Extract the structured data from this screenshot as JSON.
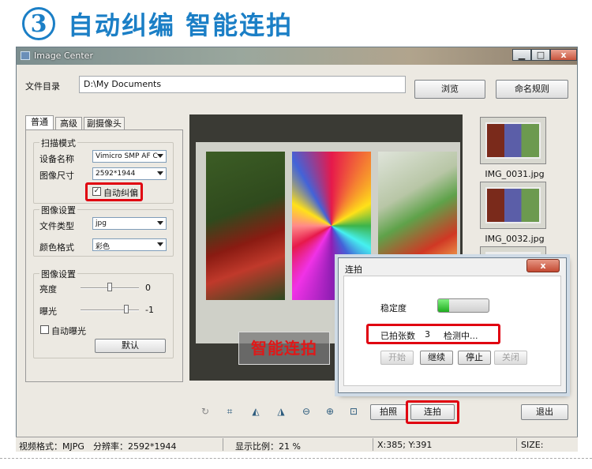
{
  "headline": {
    "step": "3",
    "title": "自动纠编 智能连拍"
  },
  "window": {
    "title": "Image Center",
    "minimize": "▁",
    "maximize": "□",
    "close": "x"
  },
  "directory": {
    "label": "文件目录",
    "value": "D:\\My Documents",
    "browse": "浏览",
    "naming": "命名规则"
  },
  "tabs": [
    "普通",
    "高级",
    "副摄像头"
  ],
  "scan_mode": {
    "group_label": "扫描模式",
    "device_label": "设备名称",
    "device_value": "Vimicro SMP AF C",
    "size_label": "图像尺寸",
    "size_value": "2592*1944",
    "auto_correct_label": "自动纠偏",
    "auto_correct_checked": true
  },
  "image_settings": {
    "group_label": "图像设置",
    "file_type_label": "文件类型",
    "file_type_value": "jpg",
    "color_label": "颜色格式",
    "color_value": "彩色"
  },
  "image_settings2": {
    "group_label": "图像设置",
    "brightness_label": "亮度",
    "brightness_value": "0",
    "exposure_label": "曝光",
    "exposure_value": "-1",
    "auto_exposure_label": "自动曝光",
    "default_button": "默认"
  },
  "preview_badge": "智能连拍",
  "thumbnails": [
    {
      "name": "IMG_0031.jpg"
    },
    {
      "name": "IMG_0032.jpg"
    }
  ],
  "burst_dialog": {
    "title": "连拍",
    "close": "x",
    "stability_label": "稳定度",
    "stability_level": 0.22,
    "count_label": "已拍张数",
    "count_value": "3",
    "status_text": "检测中...",
    "buttons": {
      "start": "开始",
      "continue": "继续",
      "stop": "停止",
      "close": "关闭"
    }
  },
  "toolbar": {
    "photo": "拍照",
    "burst": "连拍",
    "exit": "退出"
  },
  "statusbar": {
    "video_format": "视频格式：MJPG",
    "resolution": "分辨率：2592*1944",
    "zoom": "显示比例：21 %",
    "coords": "X:385; Y:391",
    "size": "SIZE:"
  },
  "colors": {
    "accent": "#1b7fc6",
    "highlight": "#e00010"
  }
}
